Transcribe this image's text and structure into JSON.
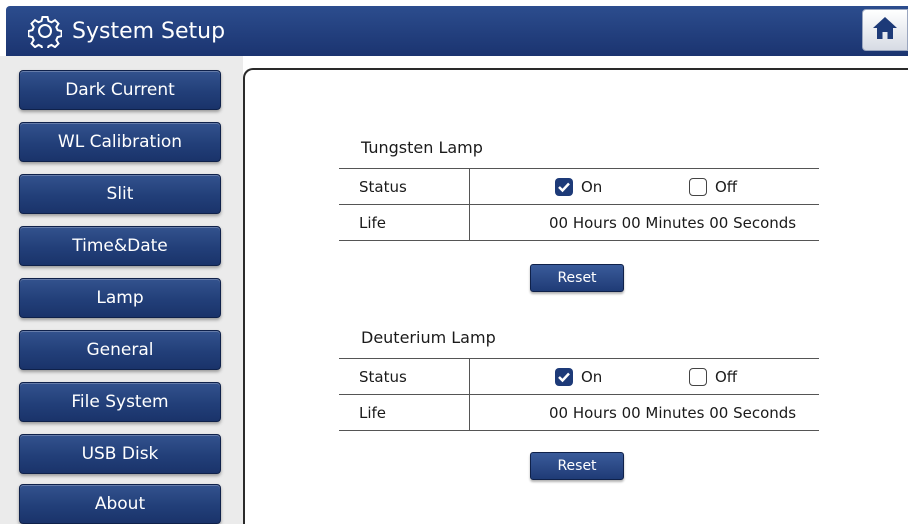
{
  "header": {
    "title": "System Setup",
    "icon": "gear-icon",
    "home_icon": "home-icon"
  },
  "sidebar": {
    "items": [
      {
        "label": "Dark Current"
      },
      {
        "label": "WL Calibration"
      },
      {
        "label": "Slit"
      },
      {
        "label": "Time&Date"
      },
      {
        "label": "Lamp"
      },
      {
        "label": "General"
      },
      {
        "label": "File System"
      },
      {
        "label": "USB Disk"
      },
      {
        "label": "About"
      }
    ]
  },
  "lamps": [
    {
      "title": "Tungsten Lamp",
      "status_label": "Status",
      "on_label": "On",
      "off_label": "Off",
      "on_checked": true,
      "off_checked": false,
      "life_label": "Life",
      "life_value": "00 Hours 00 Minutes 00 Seconds",
      "reset_label": "Reset"
    },
    {
      "title": "Deuterium Lamp",
      "status_label": "Status",
      "on_label": "On",
      "off_label": "Off",
      "on_checked": true,
      "off_checked": false,
      "life_label": "Life",
      "life_value": "00 Hours 00 Minutes 00 Seconds",
      "reset_label": "Reset"
    }
  ],
  "colors": {
    "accent": "#1d3a78",
    "titlebar": "#223f79",
    "sidebar_bg": "#ebebeb"
  }
}
